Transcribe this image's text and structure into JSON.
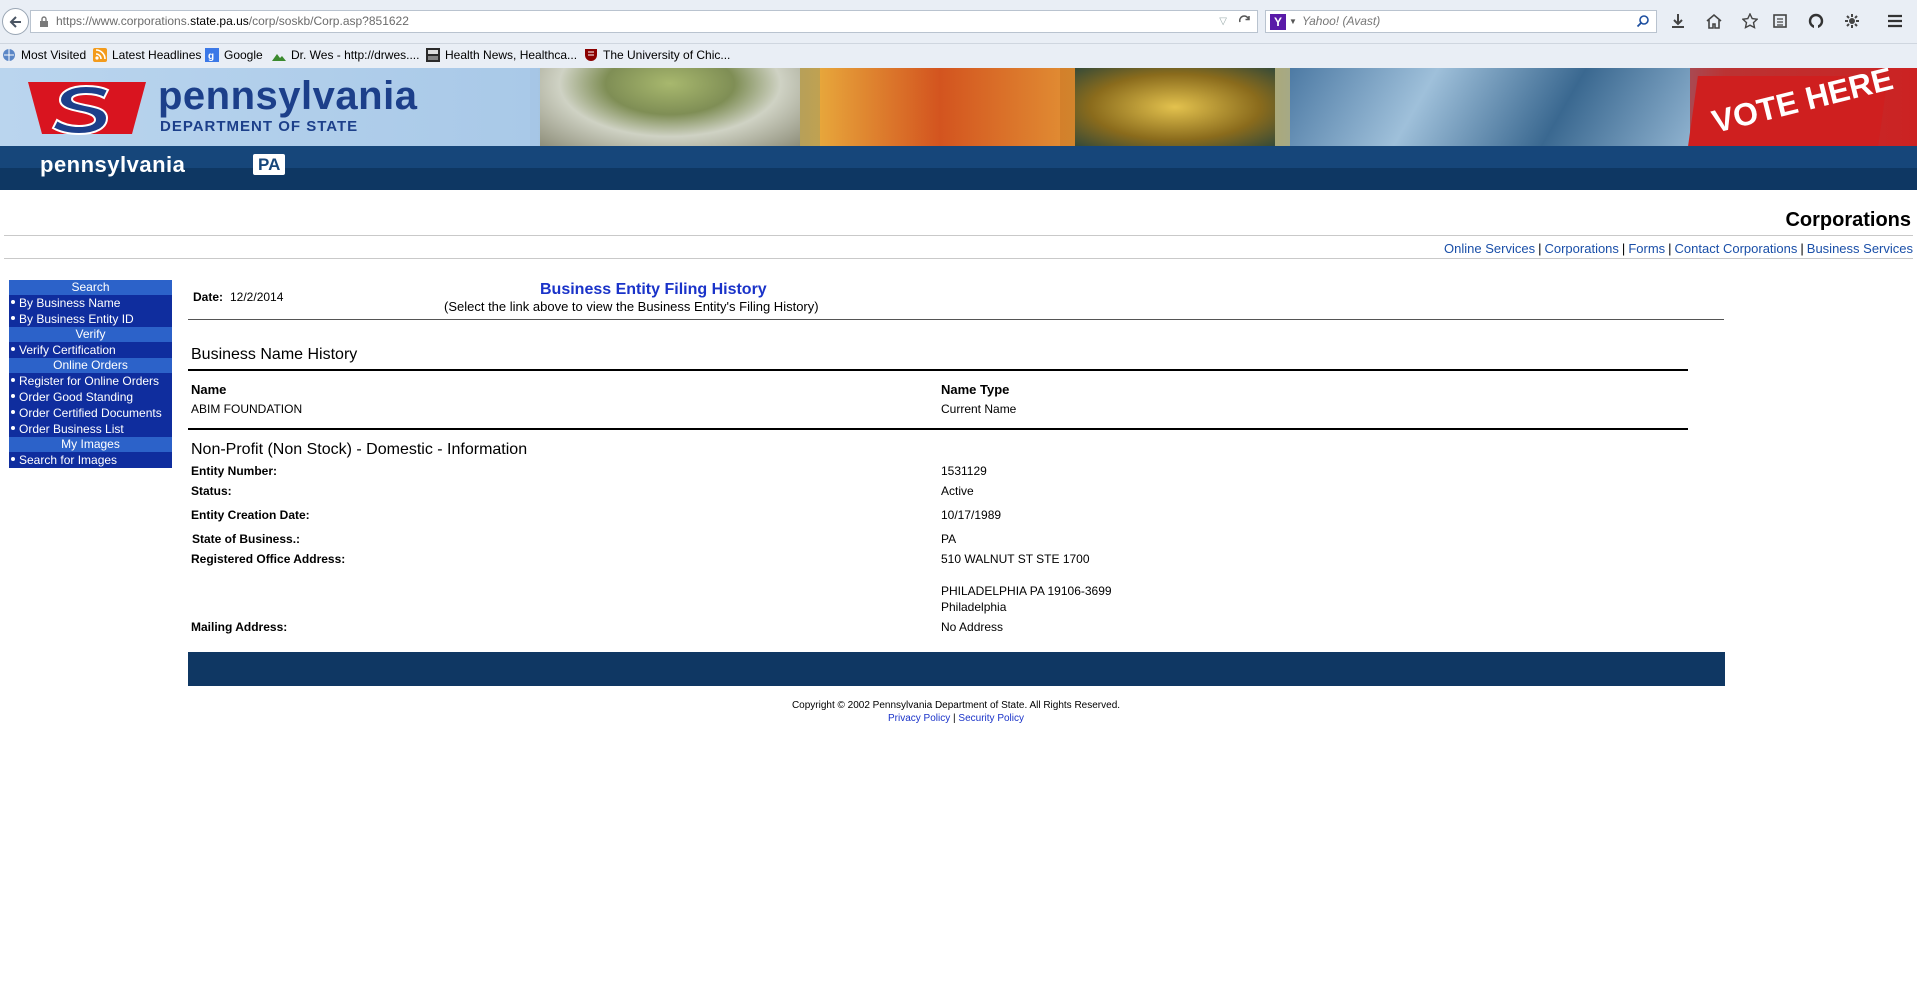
{
  "browser": {
    "url_prefix": "https://www.corporations.",
    "url_host": "state.pa.us",
    "url_path": "/corp/soskb/Corp.asp?851622",
    "search_placeholder": "Yahoo! (Avast)",
    "search_engine_letter": "Y"
  },
  "bookmarks": [
    {
      "label": "Most Visited"
    },
    {
      "label": "Latest Headlines"
    },
    {
      "label": "Google"
    },
    {
      "label": "Dr. Wes - http://drwes...."
    },
    {
      "label": "Health News, Healthca..."
    },
    {
      "label": "The University of Chic..."
    }
  ],
  "banner": {
    "title": "pennsylvania",
    "subtitle": "DEPARTMENT OF STATE",
    "strip_word": "pennsylvania",
    "strip_badge": "PA",
    "vote_sign": "VOTE HERE"
  },
  "header": {
    "section_title": "Corporations",
    "nav": [
      "Online Services",
      "Corporations",
      "Forms",
      "Contact Corporations",
      "Business Services"
    ]
  },
  "leftnav": {
    "search_head": "Search",
    "search_items": [
      "By Business Name",
      "By Business Entity ID"
    ],
    "verify_head": "Verify",
    "verify_items": [
      "Verify Certification"
    ],
    "orders_head": "Online Orders",
    "orders_items": [
      "Register for Online Orders",
      "Order Good Standing",
      "Order Certified Documents",
      "Order Business List"
    ],
    "images_head": "My Images",
    "images_items": [
      "Search for Images"
    ]
  },
  "main": {
    "date_label": "Date:",
    "date_value": "12/2/2014",
    "filing_link": "Business Entity Filing History",
    "filing_note": "(Select the link above to view the Business Entity's Filing History)",
    "name_history_title": "Business Name History",
    "col_name": "Name",
    "col_type": "Name Type",
    "entity_name": "ABIM FOUNDATION",
    "name_type": "Current Name",
    "info_title": "Non-Profit (Non Stock) - Domestic - Information",
    "fields": {
      "entity_number_label": "Entity Number:",
      "entity_number": "1531129",
      "status_label": "Status:",
      "status": "Active",
      "creation_label": "Entity Creation Date:",
      "creation": "10/17/1989",
      "state_label": "State of Business.:",
      "state": "PA",
      "reg_office_label": "Registered Office Address:",
      "reg_line1": "510 WALNUT ST STE 1700",
      "reg_line2": "PHILADELPHIA PA 19106-3699",
      "reg_line3": "Philadelphia",
      "mailing_label": "Mailing Address:",
      "mailing": "No Address"
    }
  },
  "footer": {
    "copyright": "Copyright © 2002 Pennsylvania Department of State. All Rights Reserved.",
    "privacy": "Privacy Policy",
    "separator": "|",
    "security": "Security Policy"
  }
}
